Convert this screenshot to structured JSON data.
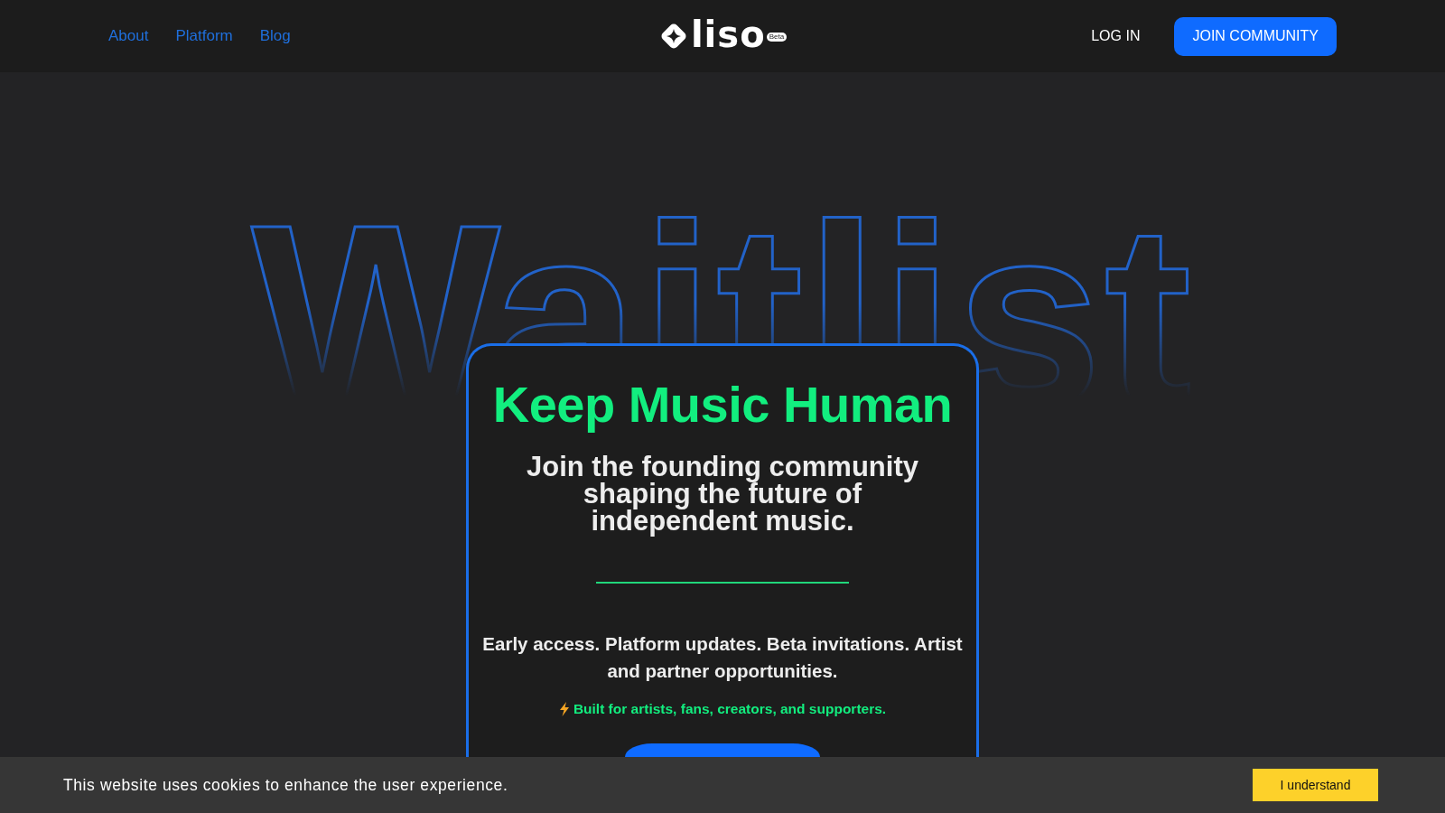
{
  "nav": {
    "links": [
      {
        "label": "About"
      },
      {
        "label": "Platform"
      },
      {
        "label": "Blog"
      }
    ],
    "logo": {
      "name": "liso",
      "badge": "Beta"
    },
    "login": "LOG IN",
    "cta": "JOIN COMMUNITY"
  },
  "hero": {
    "backdrop_word": "Waitlist",
    "card": {
      "title": "Keep Music Human",
      "subtitle": "Join the founding community shaping the future of independent music.",
      "body": "Early access. Platform updates. Beta invitations. Artist and partner opportunities.",
      "tagline": "Built for artists, fans, creators, and supporters."
    }
  },
  "cookie_banner": {
    "message": "This website uses cookies to enhance the user experience.",
    "button": "I understand"
  }
}
